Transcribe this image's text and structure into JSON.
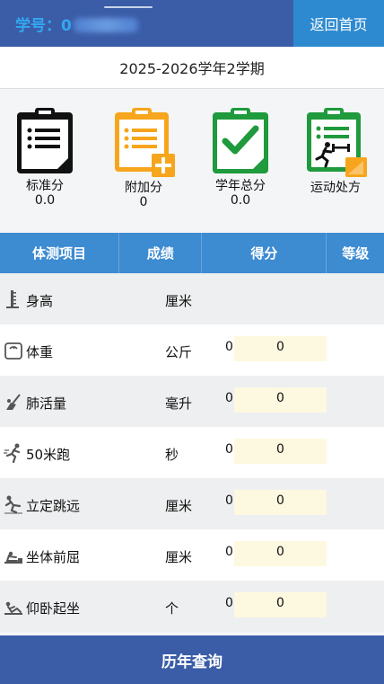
{
  "header": {
    "student_label": "学号：0",
    "home_button": "返回首页"
  },
  "term": "2025-2026学年2学期",
  "summary": [
    {
      "icon": "clipboard-list-icon",
      "label": "标准分",
      "value": "0.0",
      "color": "#111111"
    },
    {
      "icon": "clipboard-plus-icon",
      "label": "附加分",
      "value": "0",
      "color": "#f7a51c"
    },
    {
      "icon": "clipboard-check-icon",
      "label": "学年总分",
      "value": "0.0",
      "color": "#1f9a3c"
    },
    {
      "icon": "clipboard-exercise-icon",
      "label": "运动处方",
      "value": "",
      "color": "#1f9a3c"
    }
  ],
  "table": {
    "headers": [
      "体测项目",
      "成绩",
      "得分",
      "等级"
    ],
    "rows": [
      {
        "icon": "height-icon",
        "name": "身高",
        "unit": "厘米",
        "score": "",
        "grade": ""
      },
      {
        "icon": "scale-icon",
        "name": "体重",
        "unit": "公斤",
        "score": "0",
        "grade": "0"
      },
      {
        "icon": "lung-capacity-icon",
        "name": "肺活量",
        "unit": "毫升",
        "score": "0",
        "grade": "0"
      },
      {
        "icon": "running-icon",
        "name": "50米跑",
        "unit": "秒",
        "score": "0",
        "grade": "0"
      },
      {
        "icon": "long-jump-icon",
        "name": "立定跳远",
        "unit": "厘米",
        "score": "0",
        "grade": "0"
      },
      {
        "icon": "sit-reach-icon",
        "name": "坐体前屈",
        "unit": "厘米",
        "score": "0",
        "grade": "0"
      },
      {
        "icon": "sit-up-icon",
        "name": "仰卧起坐",
        "unit": "个",
        "score": "0",
        "grade": "0"
      }
    ]
  },
  "footer": {
    "history_button": "历年查询"
  },
  "colors": {
    "header_bg": "#3b5da8",
    "home_btn_bg": "#2e8ad0",
    "table_header_bg": "#3d8bd1",
    "grade_cell_bg": "#fdf8e0"
  }
}
